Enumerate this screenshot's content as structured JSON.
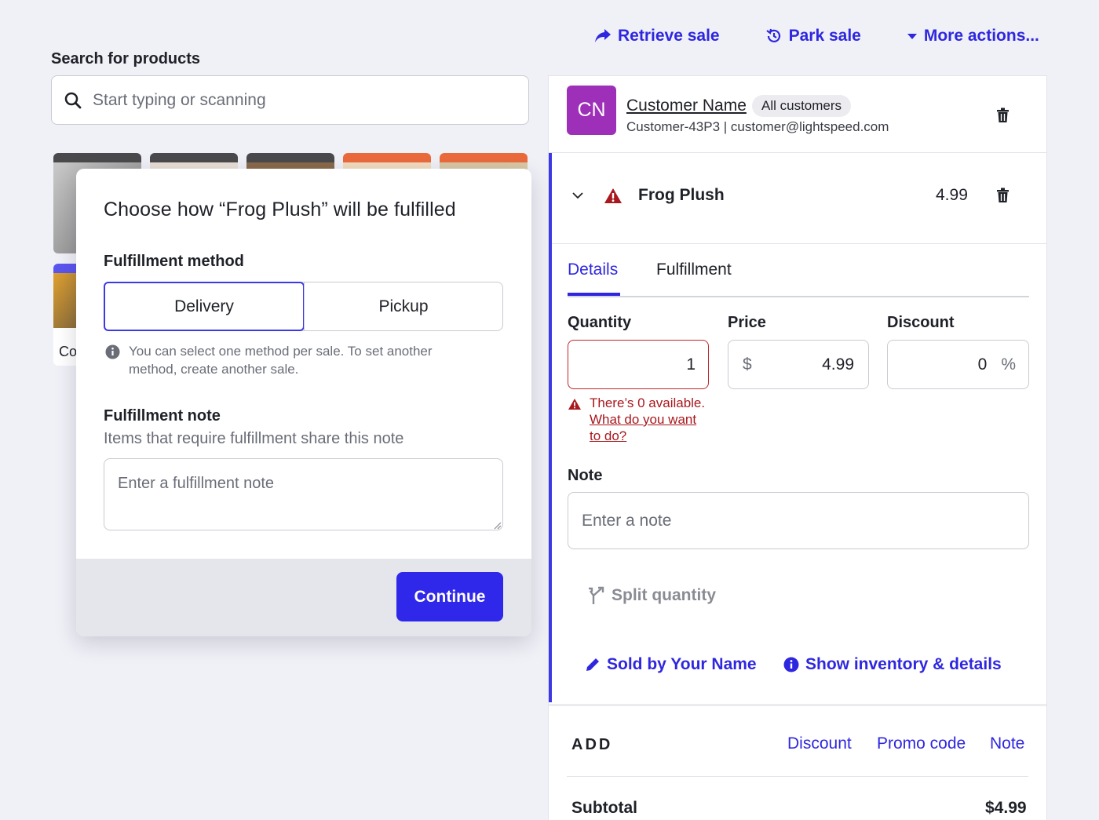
{
  "top_actions": {
    "retrieve": "Retrieve sale",
    "park": "Park sale",
    "more": "More actions..."
  },
  "search": {
    "label": "Search for products",
    "placeholder": "Start typing or scanning"
  },
  "product_tiles": {
    "partial_label": "Co"
  },
  "modal": {
    "title": "Choose how “Frog Plush” will be fulfilled",
    "method_label": "Fulfillment method",
    "options": [
      "Delivery",
      "Pickup"
    ],
    "selected": "Delivery",
    "info": "You can select one method per sale. To set another method, create another sale.",
    "note_label": "Fulfillment note",
    "note_sub": "Items that require fulfillment share this note",
    "note_placeholder": "Enter a fulfillment note",
    "continue": "Continue"
  },
  "customer": {
    "initials": "CN",
    "name": "Customer Name",
    "badge": "All customers",
    "details": "Customer-43P3 | customer@lightspeed.com",
    "avatar_color": "#9d2fb8"
  },
  "line_item": {
    "name": "Frog Plush",
    "price": "4.99",
    "tabs": [
      "Details",
      "Fulfillment"
    ],
    "active_tab": "Details",
    "quantity_label": "Quantity",
    "quantity": "1",
    "price_label": "Price",
    "currency": "$",
    "price_value": "4.99",
    "discount_label": "Discount",
    "discount": "0",
    "discount_unit": "%",
    "error_text": "There’s 0 available.",
    "error_link": "What do you want to do?",
    "note_label": "Note",
    "note_placeholder": "Enter a note",
    "split": "Split quantity",
    "sold_by": "Sold by Your Name",
    "show_inventory": "Show inventory & details"
  },
  "add": {
    "title": "ADD",
    "discount": "Discount",
    "promo": "Promo code",
    "note": "Note"
  },
  "totals": {
    "subtotal_label": "Subtotal",
    "subtotal": "$4.99"
  },
  "colors": {
    "accent": "#2f27e0",
    "error": "#a8181e",
    "background": "#f0f1f7"
  }
}
